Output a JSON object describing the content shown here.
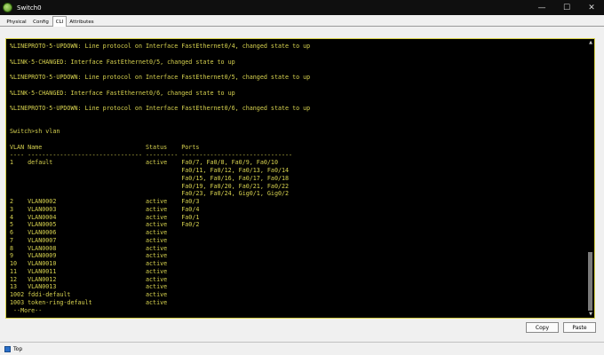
{
  "window": {
    "title": "Switch0",
    "minimize_glyph": "—",
    "maximize_glyph": "☐",
    "close_glyph": "✕"
  },
  "tabs": [
    {
      "label": "Physical",
      "active": false
    },
    {
      "label": "Config",
      "active": false
    },
    {
      "label": "CLI",
      "active": true
    },
    {
      "label": "Attributes",
      "active": false
    }
  ],
  "console_text": "%LINEPROTO-5-UPDOWN: Line protocol on Interface FastEthernet0/4, changed state to up\n\n%LINK-5-CHANGED: Interface FastEthernet0/5, changed state to up\n\n%LINEPROTO-5-UPDOWN: Line protocol on Interface FastEthernet0/5, changed state to up\n\n%LINK-5-CHANGED: Interface FastEthernet0/6, changed state to up\n\n%LINEPROTO-5-UPDOWN: Line protocol on Interface FastEthernet0/6, changed state to up\n\n\nSwitch>sh vlan\n\nVLAN Name                             Status    Ports\n---- -------------------------------- --------- -------------------------------\n1    default                          active    Fa0/7, Fa0/8, Fa0/9, Fa0/10\n                                                Fa0/11, Fa0/12, Fa0/13, Fa0/14\n                                                Fa0/15, Fa0/16, Fa0/17, Fa0/18\n                                                Fa0/19, Fa0/20, Fa0/21, Fa0/22\n                                                Fa0/23, Fa0/24, Gig0/1, Gig0/2\n2    VLAN0002                         active    Fa0/3\n3    VLAN0003                         active    Fa0/4\n4    VLAN0004                         active    Fa0/1\n5    VLAN0005                         active    Fa0/2\n6    VLAN0006                         active\n7    VLAN0007                         active\n8    VLAN0008                         active\n9    VLAN0009                         active\n10   VLAN0010                         active\n11   VLAN0011                         active\n12   VLAN0012                         active\n13   VLAN0013                         active\n1002 fddi-default                     active\n1003 token-ring-default               active\n --More--",
  "buttons": {
    "copy": "Copy",
    "paste": "Paste"
  },
  "status": {
    "top_label": "Top",
    "top_checked": true
  },
  "colors": {
    "terminal_text": "#d7d24f",
    "terminal_bg": "#000000",
    "titlebar_bg": "#0f0f0f",
    "checkbox_accent": "#2a6fc9"
  }
}
